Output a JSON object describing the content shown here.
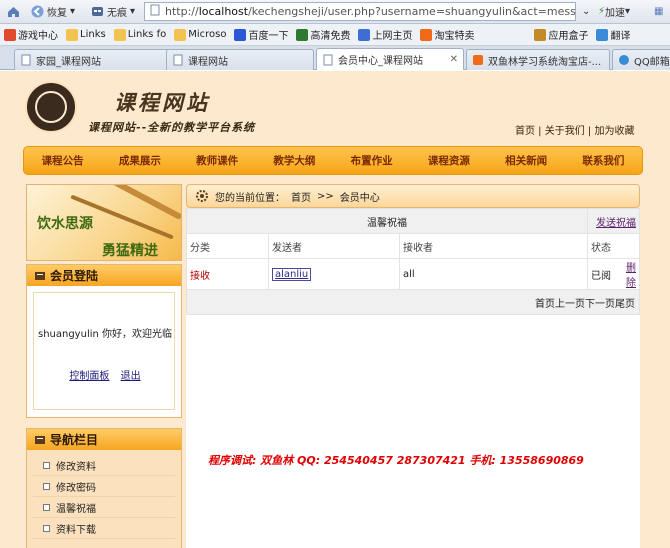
{
  "browser": {
    "back_label": "恢复",
    "fwd_label": "无痕",
    "address_prefix": "http://",
    "address_host": "localhost",
    "address_path": "/kechengsheji/user.php?username=shuangyulin&act=messa",
    "accelerate_label": "加速",
    "favorites": [
      {
        "label": "游戏中心",
        "icon": "game-icon",
        "color": "#e04a2a"
      },
      {
        "label": "Links",
        "icon": "folder-icon",
        "color": "#f3c24f"
      },
      {
        "label": "Links fo",
        "icon": "folder-icon",
        "color": "#f3c24f"
      },
      {
        "label": "Microso",
        "icon": "folder-icon",
        "color": "#f3c24f"
      },
      {
        "label": "百度一下",
        "icon": "baidu-icon",
        "color": "#2b59d6"
      },
      {
        "label": "高清免费",
        "icon": "m-icon",
        "color": "#2f7a2f"
      },
      {
        "label": "上网主页",
        "icon": "home-icon",
        "color": "#3d6fd1"
      },
      {
        "label": "淘宝特卖",
        "icon": "taobao-icon",
        "color": "#f06a1a"
      },
      {
        "label": "应用盒子",
        "icon": "box-icon",
        "color": "#c48a2a"
      },
      {
        "label": "翻译",
        "icon": "translate-icon",
        "color": "#3a8ad8"
      }
    ],
    "tabs": [
      {
        "label": "家园_课程网站",
        "active": false
      },
      {
        "label": "课程网站",
        "active": false
      },
      {
        "label": "会员中心_课程网站",
        "active": true
      },
      {
        "label": "双鱼林学习系统淘宝店-...",
        "active": false
      },
      {
        "label": "QQ邮箱",
        "active": false
      }
    ]
  },
  "site": {
    "title": "课程网站",
    "subtitle": "课程网站--全新的教学平台系统",
    "top_links": [
      "首页",
      "关于我们",
      "加为收藏"
    ],
    "nav": [
      "课程公告",
      "成果展示",
      "教师课件",
      "教学大纲",
      "布置作业",
      "课程资源",
      "相关新闻",
      "联系我们"
    ],
    "banner_line1": "饮水思源",
    "banner_line2": "勇猛精进"
  },
  "login_box": {
    "heading": "会员登陆",
    "welcome": "shuangyulin 你好，欢迎光临",
    "control_panel": "控制面板",
    "logout": "退出"
  },
  "nav_box": {
    "heading": "导航栏目",
    "items": [
      "修改资料",
      "修改密码",
      "温馨祝福",
      "资料下载"
    ]
  },
  "breadcrumb": {
    "prefix": "您的当前位置：",
    "home": "首页",
    "sep": ">>",
    "current": "会员中心"
  },
  "messages": {
    "title": "温馨祝福",
    "send_link": "发送祝福",
    "columns": [
      "分类",
      "发送者",
      "接收者",
      "状态"
    ],
    "rows": [
      {
        "type": "接收",
        "sender": "alanliu",
        "receiver": "all",
        "status": "已阅",
        "action": "删除"
      }
    ],
    "pager": "首页上一页下一页尾页"
  },
  "credits": "程序调试: 双鱼林  QQ: 254540457  287307421    手机: 13558690869"
}
